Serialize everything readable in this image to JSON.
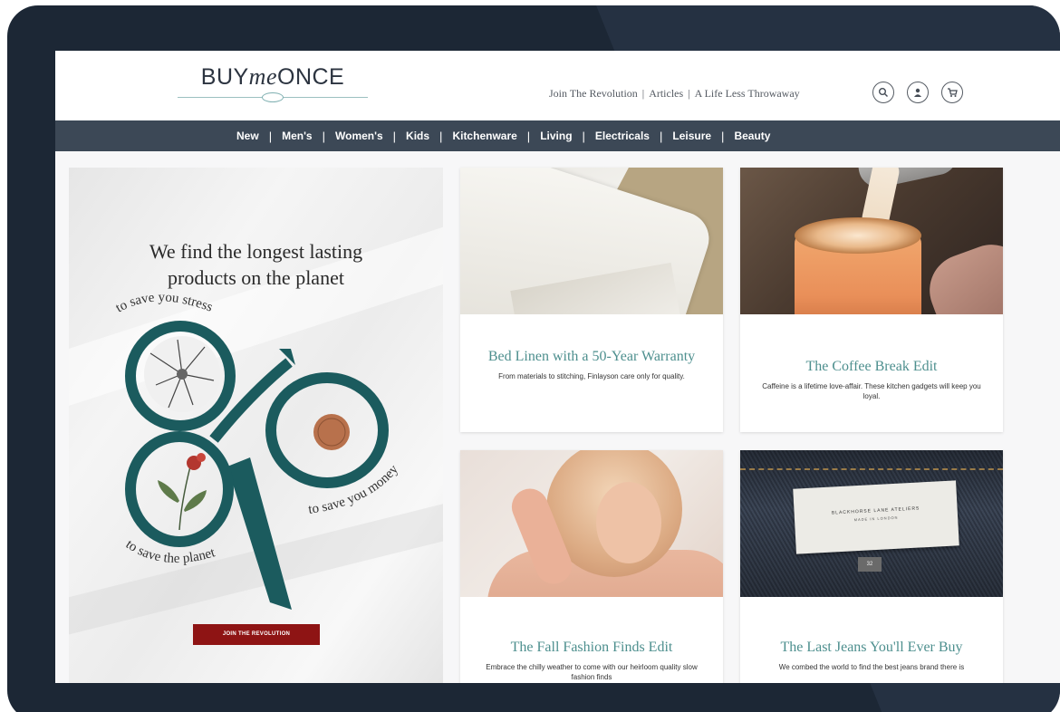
{
  "site": {
    "logo": {
      "buy": "BUY",
      "me": "me",
      "once": "ONCE"
    },
    "top_links": [
      "Join The Revolution",
      "Articles",
      "A Life Less Throwaway"
    ],
    "top_link_separator": "|",
    "header_icons": [
      "search-icon",
      "account-icon",
      "cart-icon"
    ]
  },
  "nav": {
    "items": [
      "New",
      "Men's",
      "Women's",
      "Kids",
      "Kitchenware",
      "Living",
      "Electricals",
      "Leisure",
      "Beauty"
    ],
    "separator": "|"
  },
  "hero": {
    "heading_line1": "We find the longest lasting",
    "heading_line2": "products on the planet",
    "ribbon_text_1": "to save you stress",
    "ribbon_text_2": "to save you money",
    "ribbon_text_3": "to save the planet",
    "cta": "JOIN THE REVOLUTION"
  },
  "cards": [
    {
      "title": "Bed Linen with a 50-Year Warranty",
      "desc": "From materials to stitching, Finlayson care only for quality."
    },
    {
      "title": "The Coffee Break Edit",
      "desc": "Caffeine is a lifetime love-affair. These kitchen gadgets will keep you loyal."
    },
    {
      "title": "The Fall Fashion Finds Edit",
      "desc": "Embrace the chilly weather to come with our heirloom quality slow fashion finds"
    },
    {
      "title": "The Last Jeans You'll Ever Buy",
      "desc": "We combed the world to find the best jeans brand there is"
    }
  ],
  "jeans_label": {
    "line1": "BLACKHORSE LANE ATELIERS",
    "line2": "MADE IN LONDON",
    "size": "32"
  },
  "colors": {
    "frame": "#1c2735",
    "nav_bg": "#3c4856",
    "accent_teal": "#4d8f8e",
    "cta_red": "#8e1414",
    "ribbon": "#1b5b5e"
  }
}
